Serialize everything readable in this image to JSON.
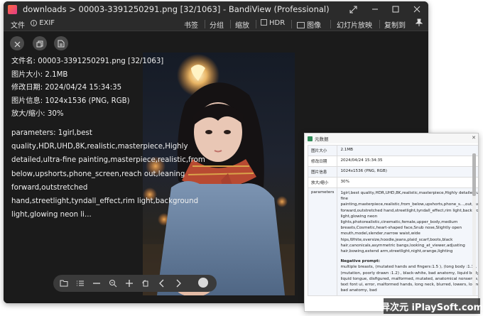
{
  "window": {
    "title": "downloads > 00003-3391250291.png [32/1063] - BandiView (Professional)"
  },
  "menu": {
    "file": "文件",
    "exif": "EXIF",
    "bookmark": "书签",
    "group": "分组",
    "zoom": "缩放",
    "hdr": "HDR",
    "image": "图像",
    "slideshow": "幻灯片放映",
    "copy_to": "复制到"
  },
  "info": {
    "filename": "文件名: 00003-3391250291.png [32/1063]",
    "filesize": "图片大小: 2.1MB",
    "modified": "修改日期: 2024/04/24 15:34:35",
    "imageinfo": "图片信息: 1024x1536 (PNG, RGB)",
    "zoom": "放大/缩小: 30%",
    "parameters": "parameters: 1girl,best quality,HDR,UHD,8K,realistic,masterpiece,Highly detailed,ultra-fine painting,masterpiece,realistic,from below,upshorts,phone_screen,reach out,leaning forward,outstretched hand,streetlight,tyndall_effect,rim light,background light,glowing neon li..."
  },
  "meta_window": {
    "title": "元数据",
    "rows": [
      {
        "key": "图片大小",
        "value": "2.1MB"
      },
      {
        "key": "修改日期",
        "value": "2024/04/24 15:34:35"
      },
      {
        "key": "图片信息",
        "value": "1024x1536 (PNG, RGB)"
      },
      {
        "key": "放大/缩小",
        "value": "30%"
      }
    ],
    "param_key": "parameters",
    "param_value": "1girl,best quality,HDR,UHD,8K,realistic,masterpiece,Highly detailed,ultra-fine painting,masterpiece,realistic,from_below,upshorts,phone_s...,out,leaning forward,outstretched hand,streetlight,tyndall_effect,rim light,background light,glowing neon lights,photorealistic,cinematic,female,upper_body,medium breasts,Cosmetic,heart-shaped face,Snub nose,Slightly open mouth,model,slender,narrow waist,wide hips,White,oversize,hoodie,jeans,plaid_scarf,boots,black hair,canonicals,asymmetric bangs,looking_at_viewer,adjusting hair,bowing,extend arm,streetlight,night,orange,lighting",
    "neg_title": "Negative prompt:",
    "neg_value": "multiple breasts, (mutated hands and fingers:1.5 ), (long body :1.3), (mutation, poorly drawn :1.2) , black-white, bad anatomy, liquid body, liquid tongue, disfigured, malformed, mutated, anatomical nonsense, text font ui, error, malformed hands, long neck, blurred, lowers, lowres, bad anatomy, bad"
  },
  "watermark": "异次元 iPlaySoft.com"
}
